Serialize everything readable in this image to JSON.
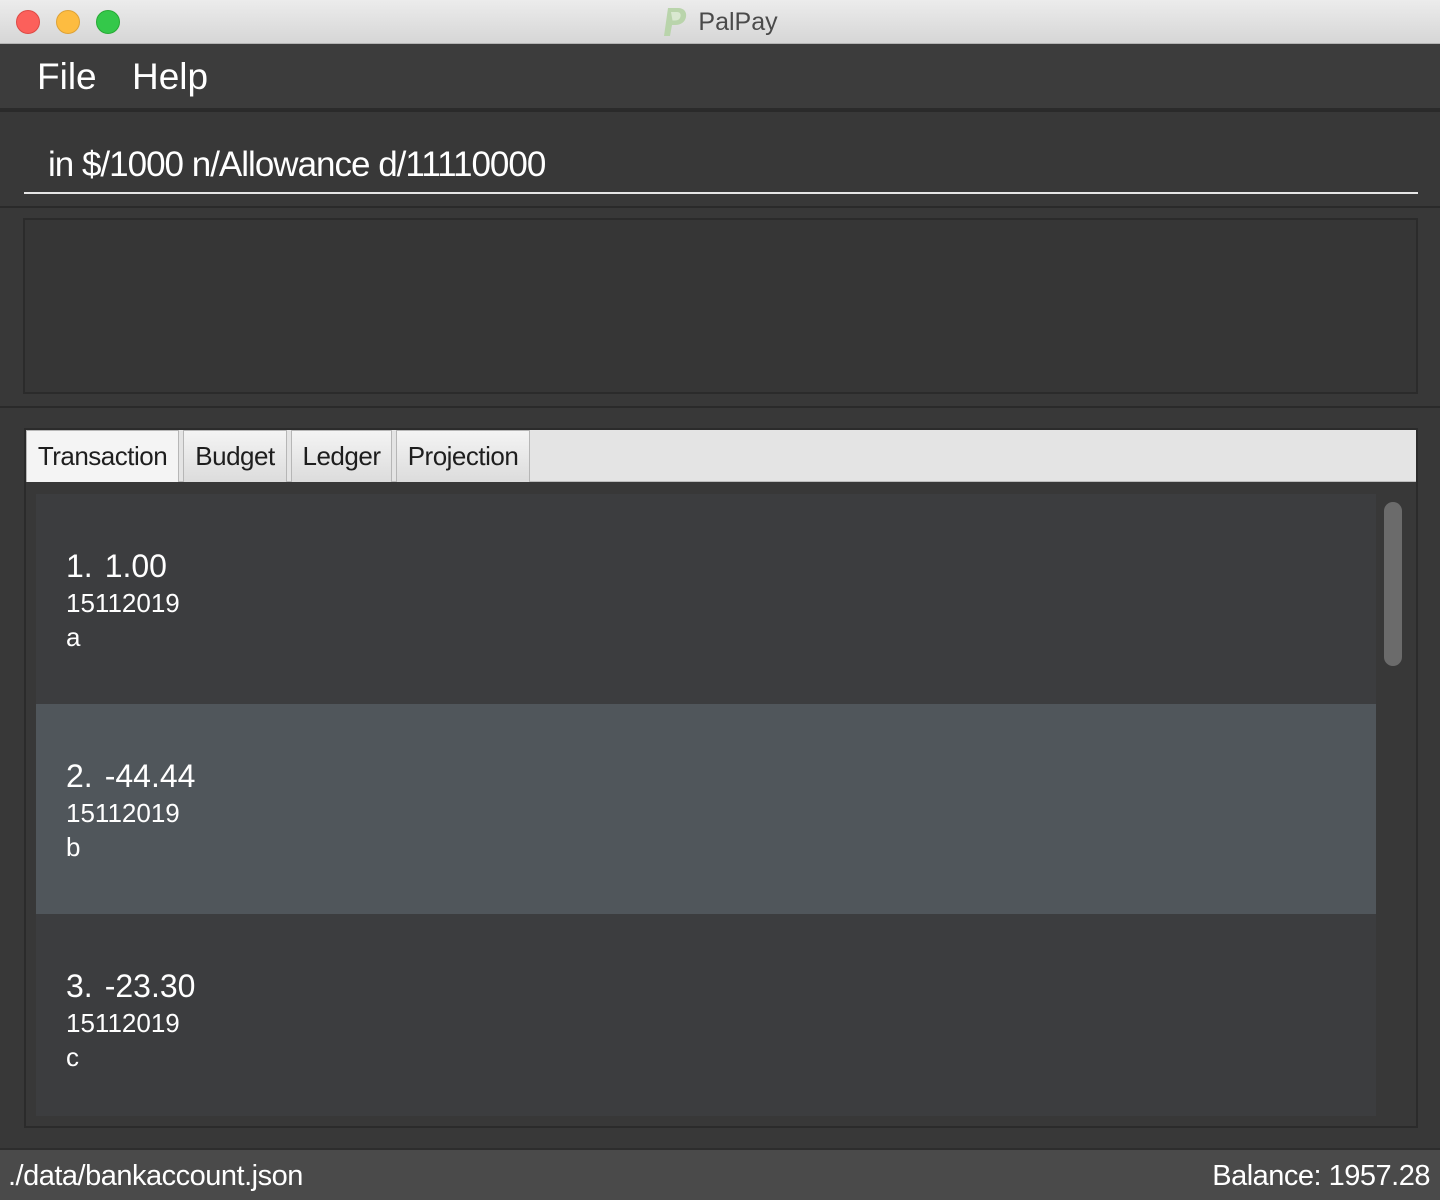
{
  "window": {
    "title": "PalPay",
    "logo_icon": "palpay-logo-icon",
    "logo_color": "#a7c49a"
  },
  "menu": {
    "items": [
      {
        "label": "File"
      },
      {
        "label": "Help"
      }
    ]
  },
  "command_box": {
    "value": "in $/1000 n/Allowance d/11110000"
  },
  "result_display": {
    "text": ""
  },
  "tabs": [
    {
      "label": "Transaction",
      "active": true
    },
    {
      "label": "Budget",
      "active": false
    },
    {
      "label": "Ledger",
      "active": false
    },
    {
      "label": "Projection",
      "active": false
    }
  ],
  "transactions": [
    {
      "index": "1.",
      "amount": "1.00",
      "date": "15112019",
      "description": "a",
      "selected": false
    },
    {
      "index": "2.",
      "amount": "-44.44",
      "date": "15112019",
      "description": "b",
      "selected": true
    },
    {
      "index": "3.",
      "amount": "-23.30",
      "date": "15112019",
      "description": "c",
      "selected": false
    }
  ],
  "status_bar": {
    "file_path": "./data/bankaccount.json",
    "balance": "Balance: 1957.28"
  },
  "colors": {
    "background": "#383838",
    "selected_row": "#50565b",
    "row": "#3c3d3f",
    "close": "#fc605b",
    "minimize": "#fdbc40",
    "zoom": "#34c84a"
  }
}
